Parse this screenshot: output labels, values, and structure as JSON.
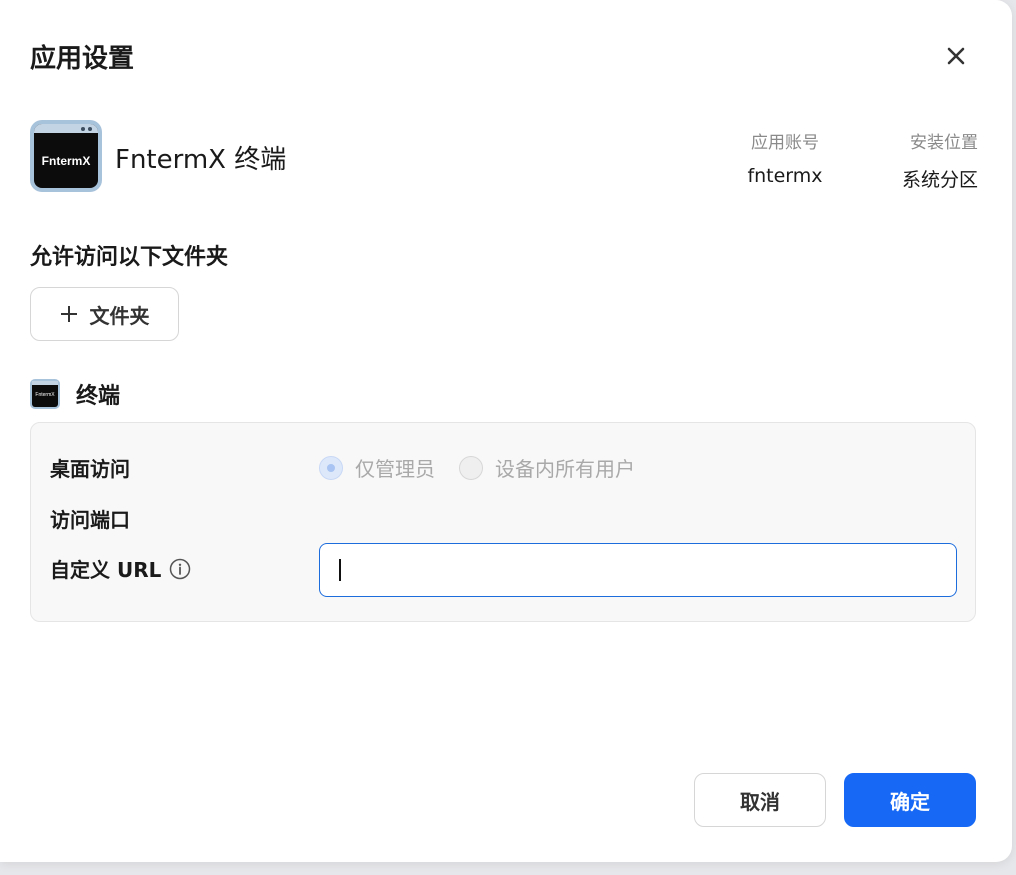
{
  "dialog": {
    "title": "应用设置",
    "close_icon": "close-icon"
  },
  "app": {
    "icon_text": "FntermX",
    "name": "FntermX 终端",
    "account_label": "应用账号",
    "account_value": "fntermx",
    "location_label": "安装位置",
    "location_value": "系统分区"
  },
  "folders": {
    "title": "允许访问以下文件夹",
    "add_button_label": "文件夹",
    "add_icon": "plus-icon"
  },
  "terminal": {
    "icon_text": "FntermX",
    "title": "终端",
    "desktop_access_label": "桌面访问",
    "desktop_access_options": [
      "仅管理员",
      "设备内所有用户"
    ],
    "desktop_access_selected": "仅管理员",
    "port_label": "访问端口",
    "custom_url_label": "自定义 URL",
    "custom_url_value": "",
    "info_icon": "info-icon"
  },
  "footer": {
    "cancel_label": "取消",
    "confirm_label": "确定"
  },
  "colors": {
    "primary": "#1769f5",
    "panel_bg": "#f8f8f8",
    "input_focus_border": "#1e6ddc"
  }
}
